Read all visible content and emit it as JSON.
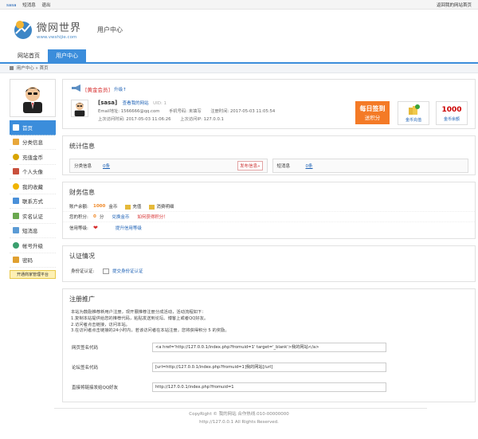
{
  "topbar": {
    "username": "sasa",
    "messages_label": "短消息",
    "logout_label": "退出",
    "back_home_label": "返回我的网站首页"
  },
  "header": {
    "logo_cn": "微网世界",
    "logo_en": "www.vwshijie.com",
    "section_title": "用户中心"
  },
  "nav": {
    "tabs": [
      "网站首页",
      "用户中心"
    ],
    "active": 1
  },
  "breadcrumb": {
    "text": "用户中心 » 首页"
  },
  "sidebar": {
    "items": [
      {
        "label": "首页",
        "icon": "home-icon",
        "color": "#ffffff",
        "active": true
      },
      {
        "label": "分类信息",
        "icon": "list-icon",
        "color": "#e8a73a"
      },
      {
        "label": "充值金币",
        "icon": "coin-icon",
        "color": "#d8a400"
      },
      {
        "label": "个人头像",
        "icon": "user-icon",
        "color": "#c9503c"
      },
      {
        "label": "我的收藏",
        "icon": "star-icon",
        "color": "#f0b400"
      },
      {
        "label": "联系方式",
        "icon": "phone-icon",
        "color": "#4a90d9"
      },
      {
        "label": "实名认证",
        "icon": "id-card-icon",
        "color": "#6aa84f"
      },
      {
        "label": "短消息",
        "icon": "message-icon",
        "color": "#5b9bd5"
      },
      {
        "label": "帐号升级",
        "icon": "upgrade-icon",
        "color": "#3a9f6e"
      },
      {
        "label": "密码",
        "icon": "lock-icon",
        "color": "#e0a030"
      }
    ],
    "merchant_button": "开通商家管理平台"
  },
  "profile": {
    "vip_label": "[黄金会员]",
    "upgrade_label": "升级↑",
    "name": "[sasa]",
    "view_site": "查看我的网站",
    "uid": "UID: 1",
    "email": "Email地址: 1566666@qq.com",
    "phone": "手机号码: 未填写",
    "reg_time": "注册时间: 2017-05-03 11:05:54",
    "last_visit": "上次访问时间: 2017-05-03 11:06:26",
    "last_ip": "上次访问IP: 127.0.0.1",
    "sign_title": "每日签到",
    "sign_sub": "送积分",
    "recharge_label": "金币充值",
    "balance_value": "1000",
    "balance_label": "金币余额"
  },
  "stats": {
    "title": "统计信息",
    "cells": [
      {
        "label": "分类信息",
        "value": "0条",
        "action": "发布信息»"
      },
      {
        "label": "短消息",
        "value": "0条"
      }
    ]
  },
  "finance": {
    "title": "财务信息",
    "rows": [
      {
        "label": "账户余额:",
        "value": "1000",
        "unit": "金币",
        "links": [
          "充值",
          "消费明细"
        ]
      },
      {
        "label": "您的积分:",
        "value": "0",
        "unit": "分",
        "links": [
          "兑换金币"
        ],
        "extra": "如何获得积分！"
      },
      {
        "label": "信用等级:",
        "links": [
          "提升信用等级"
        ]
      }
    ]
  },
  "cert": {
    "title": "认证情况",
    "label": "身份证认证:",
    "action": "提交身份证认证"
  },
  "register": {
    "title": "注册推广",
    "lines": [
      "本站为鼓励推荐新用户注册，现开展推荐注册分成活动，活动流程如下：",
      "1.复制本站提供给您的推荐代码，粘贴发送到论坛、博客上或者QQ好友。",
      "2.访问者点击链接，访问本站。",
      "3.在访问者点击链接的24小时内，若该访问者在本站注册，您将获得积分 5 的奖励。"
    ],
    "links": [
      {
        "label": "网页签名代码",
        "value": "<a href='http://127.0.0.1/index.php?fromuid=1' target='_blank'>我的网站</a>"
      },
      {
        "label": "论坛签名代码",
        "value": "[url=http://127.0.0.1/index.php?fromuid=1]我的网站[/url]"
      },
      {
        "label": "直接将链接发给QQ好友",
        "value": "http://127.0.0.1/index.php?fromuid=1"
      }
    ]
  },
  "footer": {
    "line1": "CopyRight © 我的网站 合作热线:010-00000000",
    "line2": "http://127.0.0.1 All Rights Reserved."
  }
}
